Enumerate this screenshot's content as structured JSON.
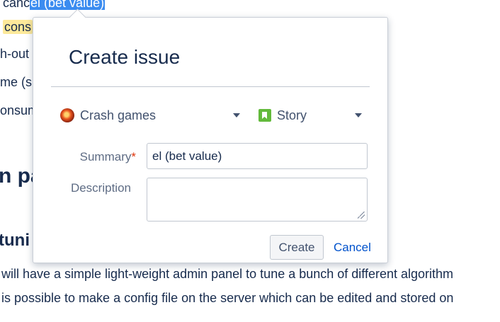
{
  "background": {
    "line1_prefix": "canc",
    "line1_selected": "el (bet value)",
    "line2_highlight": "cons",
    "line3": "h-out",
    "line4": "me (s",
    "line5": "onsum",
    "heading2": "n pa",
    "heading3": "tuni",
    "para1": "will have a simple light-weight admin panel to tune a bunch of different algorithm",
    "para2": "is possible to make a config file on the server which can be edited and stored on"
  },
  "dialog": {
    "title": "Create issue",
    "project": {
      "label": "Crash games",
      "icon": "project-avatar-icon"
    },
    "issue_type": {
      "label": "Story",
      "icon": "story-icon"
    },
    "summary_label": "Summary",
    "required_mark": "*",
    "summary_value": "el (bet value)",
    "description_label": "Description",
    "description_value": "",
    "create_label": "Create",
    "cancel_label": "Cancel"
  },
  "colors": {
    "selection": "#3b8cf0",
    "highlight": "#fde99a",
    "link": "#0052cc",
    "story": "#63ba3c",
    "required": "#de350b"
  }
}
